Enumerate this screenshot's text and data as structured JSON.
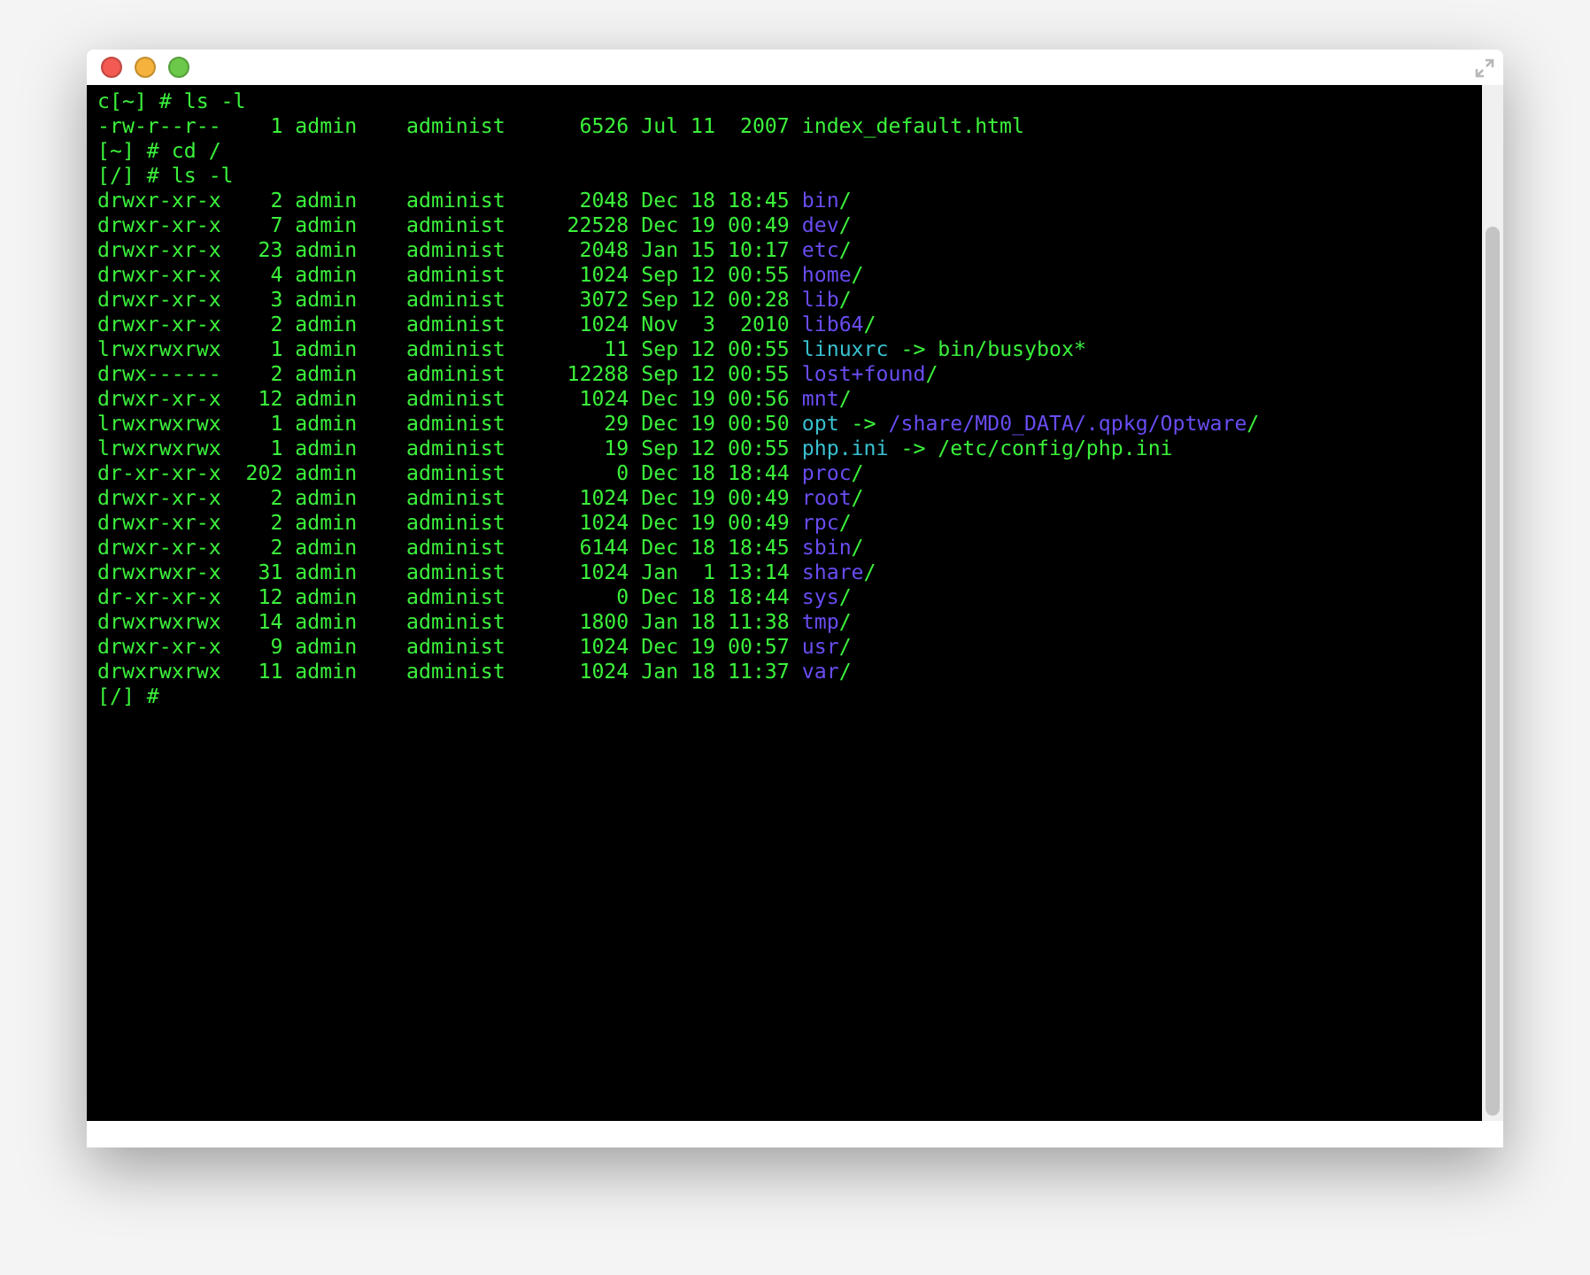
{
  "window": {
    "buttons": [
      {
        "kind": "close"
      },
      {
        "kind": "minimize"
      },
      {
        "kind": "zoom"
      }
    ]
  },
  "terminal": {
    "lines": [
      {
        "segments": [
          {
            "kind": "plain",
            "text": "c[~] # ls -l"
          }
        ]
      },
      {
        "segments": [
          {
            "kind": "plain",
            "text": "-rw-r--r--    1 admin    administ      6526 Jul 11  2007 index_default.html"
          }
        ]
      },
      {
        "segments": [
          {
            "kind": "plain",
            "text": "[~] # cd /"
          }
        ]
      },
      {
        "segments": [
          {
            "kind": "plain",
            "text": "[/] # ls -l"
          }
        ]
      },
      {
        "segments": [
          {
            "kind": "plain",
            "text": "drwxr-xr-x    2 admin    administ      2048 Dec 18 18:45 "
          },
          {
            "kind": "dir",
            "text": "bin"
          },
          {
            "kind": "plain",
            "text": "/"
          }
        ]
      },
      {
        "segments": [
          {
            "kind": "plain",
            "text": "drwxr-xr-x    7 admin    administ     22528 Dec 19 00:49 "
          },
          {
            "kind": "dir",
            "text": "dev"
          },
          {
            "kind": "plain",
            "text": "/"
          }
        ]
      },
      {
        "segments": [
          {
            "kind": "plain",
            "text": "drwxr-xr-x   23 admin    administ      2048 Jan 15 10:17 "
          },
          {
            "kind": "dir",
            "text": "etc"
          },
          {
            "kind": "plain",
            "text": "/"
          }
        ]
      },
      {
        "segments": [
          {
            "kind": "plain",
            "text": "drwxr-xr-x    4 admin    administ      1024 Sep 12 00:55 "
          },
          {
            "kind": "dir",
            "text": "home"
          },
          {
            "kind": "plain",
            "text": "/"
          }
        ]
      },
      {
        "segments": [
          {
            "kind": "plain",
            "text": "drwxr-xr-x    3 admin    administ      3072 Sep 12 00:28 "
          },
          {
            "kind": "dir",
            "text": "lib"
          },
          {
            "kind": "plain",
            "text": "/"
          }
        ]
      },
      {
        "segments": [
          {
            "kind": "plain",
            "text": "drwxr-xr-x    2 admin    administ      1024 Nov  3  2010 "
          },
          {
            "kind": "dir",
            "text": "lib64"
          },
          {
            "kind": "plain",
            "text": "/"
          }
        ]
      },
      {
        "segments": [
          {
            "kind": "plain",
            "text": "lrwxrwxrwx    1 admin    administ        11 Sep 12 00:55 "
          },
          {
            "kind": "link",
            "text": "linuxrc"
          },
          {
            "kind": "plain",
            "text": " -> bin/busybox*"
          }
        ]
      },
      {
        "segments": [
          {
            "kind": "plain",
            "text": "drwx------    2 admin    administ     12288 Sep 12 00:55 "
          },
          {
            "kind": "dir",
            "text": "lost+found"
          },
          {
            "kind": "plain",
            "text": "/"
          }
        ]
      },
      {
        "segments": [
          {
            "kind": "plain",
            "text": "drwxr-xr-x   12 admin    administ      1024 Dec 19 00:56 "
          },
          {
            "kind": "dir",
            "text": "mnt"
          },
          {
            "kind": "plain",
            "text": "/"
          }
        ]
      },
      {
        "segments": [
          {
            "kind": "plain",
            "text": "lrwxrwxrwx    1 admin    administ        29 Dec 19 00:50 "
          },
          {
            "kind": "link",
            "text": "opt"
          },
          {
            "kind": "plain",
            "text": " -> "
          },
          {
            "kind": "dir",
            "text": "/share/MD0_DATA/.qpkg/Optware"
          },
          {
            "kind": "plain",
            "text": "/"
          }
        ]
      },
      {
        "segments": [
          {
            "kind": "plain",
            "text": "lrwxrwxrwx    1 admin    administ        19 Sep 12 00:55 "
          },
          {
            "kind": "link",
            "text": "php.ini"
          },
          {
            "kind": "plain",
            "text": " -> /etc/config/php.ini"
          }
        ]
      },
      {
        "segments": [
          {
            "kind": "plain",
            "text": "dr-xr-xr-x  202 admin    administ         0 Dec 18 18:44 "
          },
          {
            "kind": "dir",
            "text": "proc"
          },
          {
            "kind": "plain",
            "text": "/"
          }
        ]
      },
      {
        "segments": [
          {
            "kind": "plain",
            "text": "drwxr-xr-x    2 admin    administ      1024 Dec 19 00:49 "
          },
          {
            "kind": "dir",
            "text": "root"
          },
          {
            "kind": "plain",
            "text": "/"
          }
        ]
      },
      {
        "segments": [
          {
            "kind": "plain",
            "text": "drwxr-xr-x    2 admin    administ      1024 Dec 19 00:49 "
          },
          {
            "kind": "dir",
            "text": "rpc"
          },
          {
            "kind": "plain",
            "text": "/"
          }
        ]
      },
      {
        "segments": [
          {
            "kind": "plain",
            "text": "drwxr-xr-x    2 admin    administ      6144 Dec 18 18:45 "
          },
          {
            "kind": "dir",
            "text": "sbin"
          },
          {
            "kind": "plain",
            "text": "/"
          }
        ]
      },
      {
        "segments": [
          {
            "kind": "plain",
            "text": "drwxrwxr-x   31 admin    administ      1024 Jan  1 13:14 "
          },
          {
            "kind": "dir",
            "text": "share"
          },
          {
            "kind": "plain",
            "text": "/"
          }
        ]
      },
      {
        "segments": [
          {
            "kind": "plain",
            "text": "dr-xr-xr-x   12 admin    administ         0 Dec 18 18:44 "
          },
          {
            "kind": "dir",
            "text": "sys"
          },
          {
            "kind": "plain",
            "text": "/"
          }
        ]
      },
      {
        "segments": [
          {
            "kind": "plain",
            "text": "drwxrwxrwx   14 admin    administ      1800 Jan 18 11:38 "
          },
          {
            "kind": "dir",
            "text": "tmp"
          },
          {
            "kind": "plain",
            "text": "/"
          }
        ]
      },
      {
        "segments": [
          {
            "kind": "plain",
            "text": "drwxr-xr-x    9 admin    administ      1024 Dec 19 00:57 "
          },
          {
            "kind": "dir",
            "text": "usr"
          },
          {
            "kind": "plain",
            "text": "/"
          }
        ]
      },
      {
        "segments": [
          {
            "kind": "plain",
            "text": "drwxrwxrwx   11 admin    administ      1024 Jan 18 11:37 "
          },
          {
            "kind": "dir",
            "text": "var"
          },
          {
            "kind": "plain",
            "text": "/"
          }
        ]
      },
      {
        "segments": [
          {
            "kind": "plain",
            "text": "[/] #"
          }
        ]
      }
    ]
  }
}
